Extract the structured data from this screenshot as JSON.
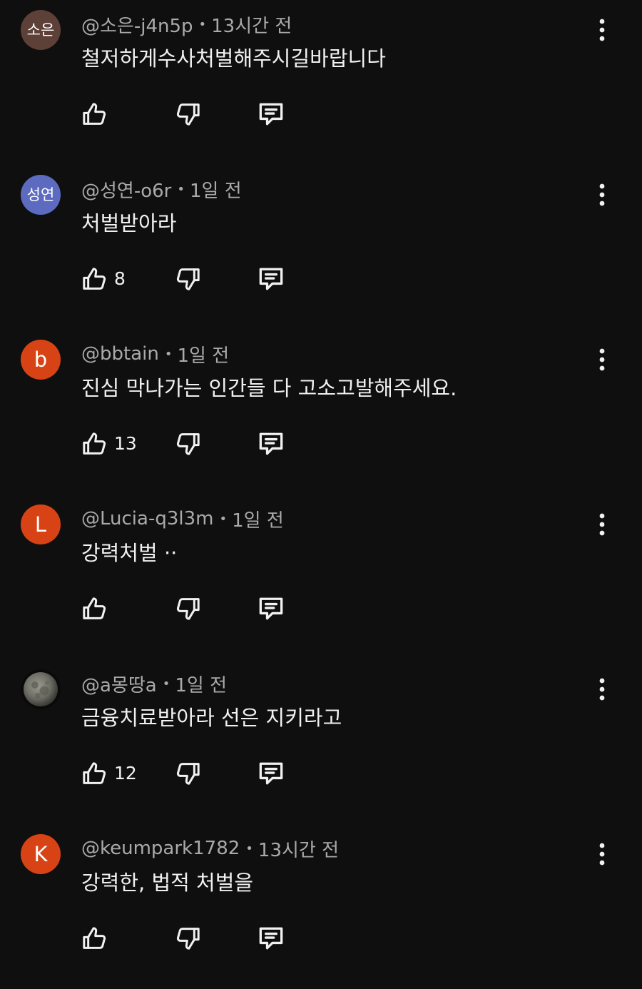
{
  "comments": [
    {
      "avatar": {
        "text": "소은",
        "color": "#5d4037",
        "type": "text"
      },
      "author": "@소은-j4n5p",
      "time": "13시간 전",
      "text": "철저하게수사처벌해주시길바랍니다",
      "likes": ""
    },
    {
      "avatar": {
        "text": "성연",
        "color": "#5c6bc0",
        "type": "text"
      },
      "author": "@성연-o6r",
      "time": "1일 전",
      "text": "처벌받아라",
      "likes": "8"
    },
    {
      "avatar": {
        "text": "b",
        "color": "#d84315",
        "type": "text"
      },
      "author": "@bbtain",
      "time": "1일 전",
      "text": "진심 막나가는 인간들 다 고소고발해주세요.",
      "likes": "13"
    },
    {
      "avatar": {
        "text": "L",
        "color": "#d84315",
        "type": "text"
      },
      "author": "@Lucia-q3l3m",
      "time": "1일 전",
      "text": "강력처벌 ··",
      "likes": ""
    },
    {
      "avatar": {
        "text": "",
        "color": "#111111",
        "type": "image"
      },
      "author": "@a몽땅a",
      "time": "1일 전",
      "text": "금융치료받아라 선은 지키라고",
      "likes": "12"
    },
    {
      "avatar": {
        "text": "K",
        "color": "#d84315",
        "type": "text"
      },
      "author": "@keumpark1782",
      "time": "13시간 전",
      "text": "강력한, 법적 처벌을",
      "likes": ""
    }
  ],
  "icons": {
    "like": "thumbs-up-icon",
    "dislike": "thumbs-down-icon",
    "reply": "reply-icon",
    "more": "more-vert-icon"
  },
  "separator": "•"
}
